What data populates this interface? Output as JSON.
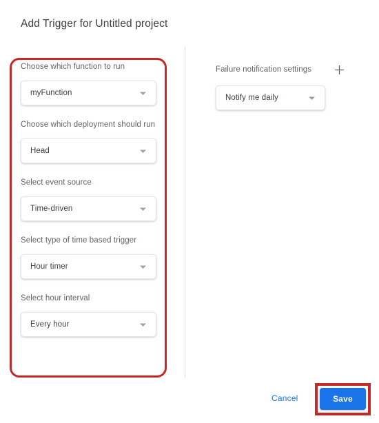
{
  "dialog": {
    "title": "Add Trigger for Untitled project"
  },
  "left_column": {
    "fields": [
      {
        "label": "Choose which function to run",
        "value": "myFunction",
        "name": "function-to-run"
      },
      {
        "label": "Choose which deployment should run",
        "value": "Head",
        "name": "deployment-to-run"
      },
      {
        "label": "Select event source",
        "value": "Time-driven",
        "name": "event-source"
      },
      {
        "label": "Select type of time based trigger",
        "value": "Hour timer",
        "name": "time-based-trigger-type"
      },
      {
        "label": "Select hour interval",
        "value": "Every hour",
        "name": "hour-interval"
      }
    ]
  },
  "right_column": {
    "heading": "Failure notification settings",
    "add_icon": "plus-icon",
    "notification": {
      "value": "Notify me daily"
    }
  },
  "footer": {
    "cancel_label": "Cancel",
    "save_label": "Save"
  },
  "icons": {
    "dropdown_arrow": "chevron-down-icon"
  },
  "colors": {
    "accent_blue": "#1a73e8",
    "annotation_red": "#c62828",
    "label_gray": "#5f6368",
    "text_dark": "#3c4043",
    "divider_gray": "#dadce0"
  }
}
